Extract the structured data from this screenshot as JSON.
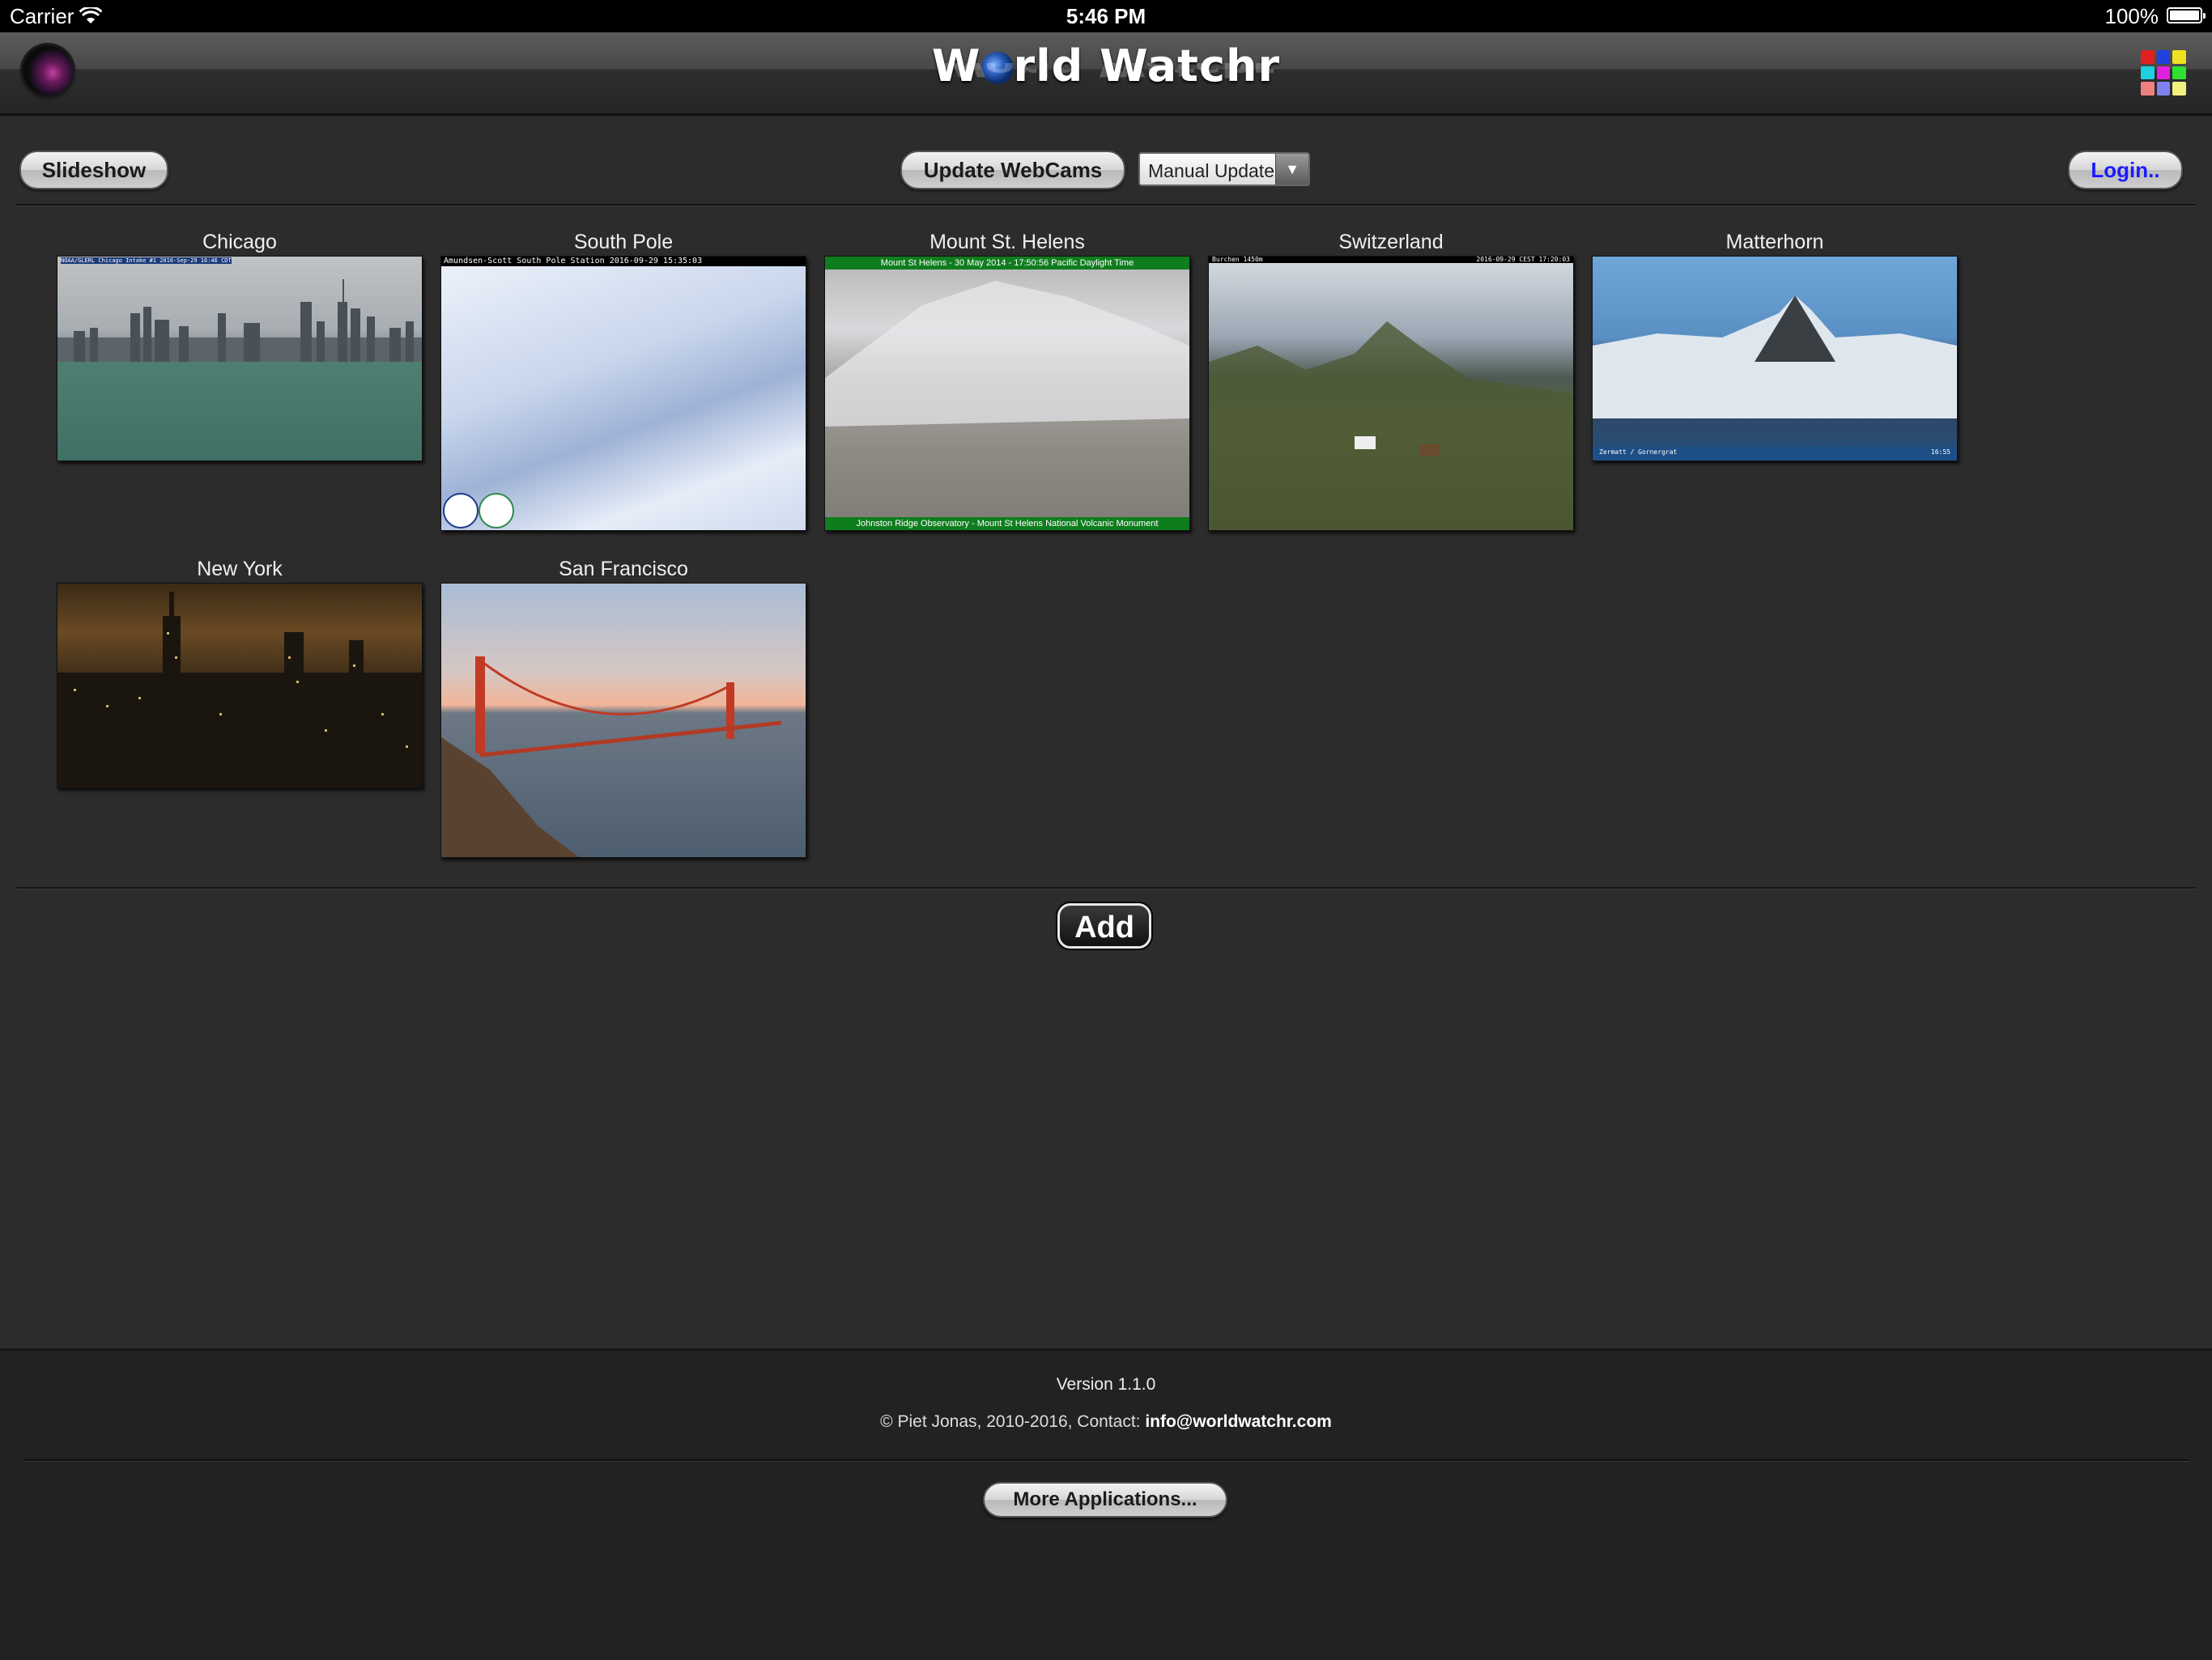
{
  "status_bar": {
    "carrier": "Carrier",
    "time": "5:46 PM",
    "battery": "100%"
  },
  "header": {
    "title_before": "W",
    "title_after": "rld Watchr",
    "reflection": "World Watchr"
  },
  "toolbar": {
    "slideshow_label": "Slideshow",
    "update_label": "Update WebCams",
    "update_mode": "Manual Update",
    "login_label": "Login.."
  },
  "cams": [
    {
      "label": "Chicago",
      "overlay": "NOAA/GLERL Chicago Intake #1 2016-Sep-29 16:46 CDT"
    },
    {
      "label": "South Pole",
      "overlay": "Amundsen-Scott South Pole Station 2016-09-29 15:35:03"
    },
    {
      "label": "Mount St. Helens",
      "overlay_top": "Mount St Helens - 30 May 2014 - 17:50:56 Pacific Daylight Time",
      "overlay_bottom": "Johnston Ridge Observatory - Mount St Helens National Volcanic Monument"
    },
    {
      "label": "Switzerland",
      "overlay_left": "Burchen 1450m",
      "overlay_right": "2016-09-29 CEST 17:20:03"
    },
    {
      "label": "Matterhorn",
      "overlay_left": "Zermatt / Gornergrat",
      "overlay_right": "16:55"
    },
    {
      "label": "New York"
    },
    {
      "label": "San Francisco"
    }
  ],
  "add_label": "Add",
  "footer": {
    "version": "Version 1.1.0",
    "copyright": "© Piet Jonas, 2010-2016, Contact: ",
    "email": "info@worldwatchr.com",
    "more_label": "More Applications..."
  },
  "colors": {
    "background": "#2c2c2c",
    "login_text": "#1a1aff",
    "grid_icon": [
      "#e02020",
      "#2040e0",
      "#f0e020",
      "#20d0e0",
      "#e020e0",
      "#30e030",
      "#f08080",
      "#8080f0",
      "#f0f080"
    ]
  }
}
